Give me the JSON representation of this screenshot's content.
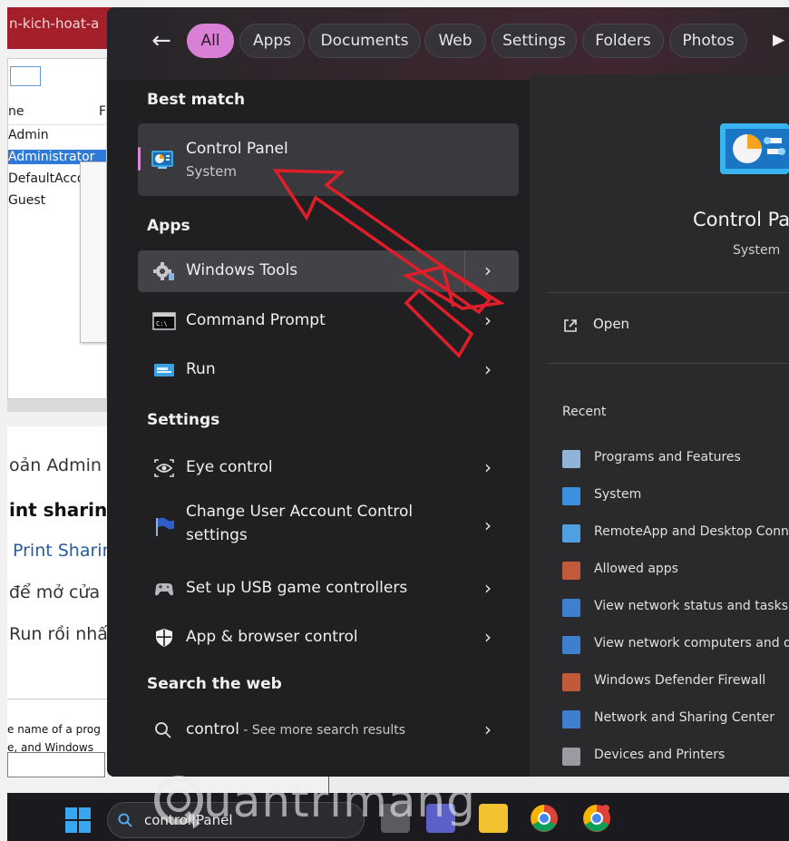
{
  "background": {
    "tab_text": "n-kich-hoat-a",
    "list_header": [
      "ne",
      "F"
    ],
    "users": [
      "Admin",
      "Administrator",
      "DefaultAcco",
      "Guest"
    ],
    "article_lines": [
      "oản Admin r",
      "int sharin",
      "Print Sharin",
      "để mở cửa",
      "Run rồi nhấn"
    ],
    "dialog_lines": [
      "e name of a prog",
      "e, and Windows"
    ]
  },
  "filters": {
    "back_label": "←",
    "chips": [
      "All",
      "Apps",
      "Documents",
      "Web",
      "Settings",
      "Folders",
      "Photos"
    ],
    "more_label": "▶"
  },
  "sections": {
    "best_match": "Best match",
    "apps": "Apps",
    "settings": "Settings",
    "search_web": "Search the web"
  },
  "best_match": {
    "label": "Control Panel",
    "sub": "System"
  },
  "apps": [
    {
      "label": "Windows Tools"
    },
    {
      "label": "Command Prompt"
    },
    {
      "label": "Run"
    }
  ],
  "settings": [
    {
      "label": "Eye control"
    },
    {
      "label": "Change User Account Control",
      "label2": "settings"
    },
    {
      "label": "Set up USB game controllers"
    },
    {
      "label": "App & browser control"
    }
  ],
  "web": {
    "query": "control",
    "hint": " - See more search results"
  },
  "preview": {
    "title": "Control Pa",
    "sub": "System",
    "open_label": "Open",
    "recent_label": "Recent",
    "recent": [
      "Programs and Features",
      "System",
      "RemoteApp and Desktop Conn",
      "Allowed apps",
      "View network status and tasks",
      "View network computers and d",
      "Windows Defender Firewall",
      "Network and Sharing Center",
      "Devices and Printers"
    ]
  },
  "taskbar": {
    "search_text": "control|Panel"
  },
  "watermark": {
    "text": "uantrimang"
  },
  "colors": {
    "accent": "#d97fd5",
    "menu_bg": "#202022",
    "arrow": "#e01e2a"
  }
}
